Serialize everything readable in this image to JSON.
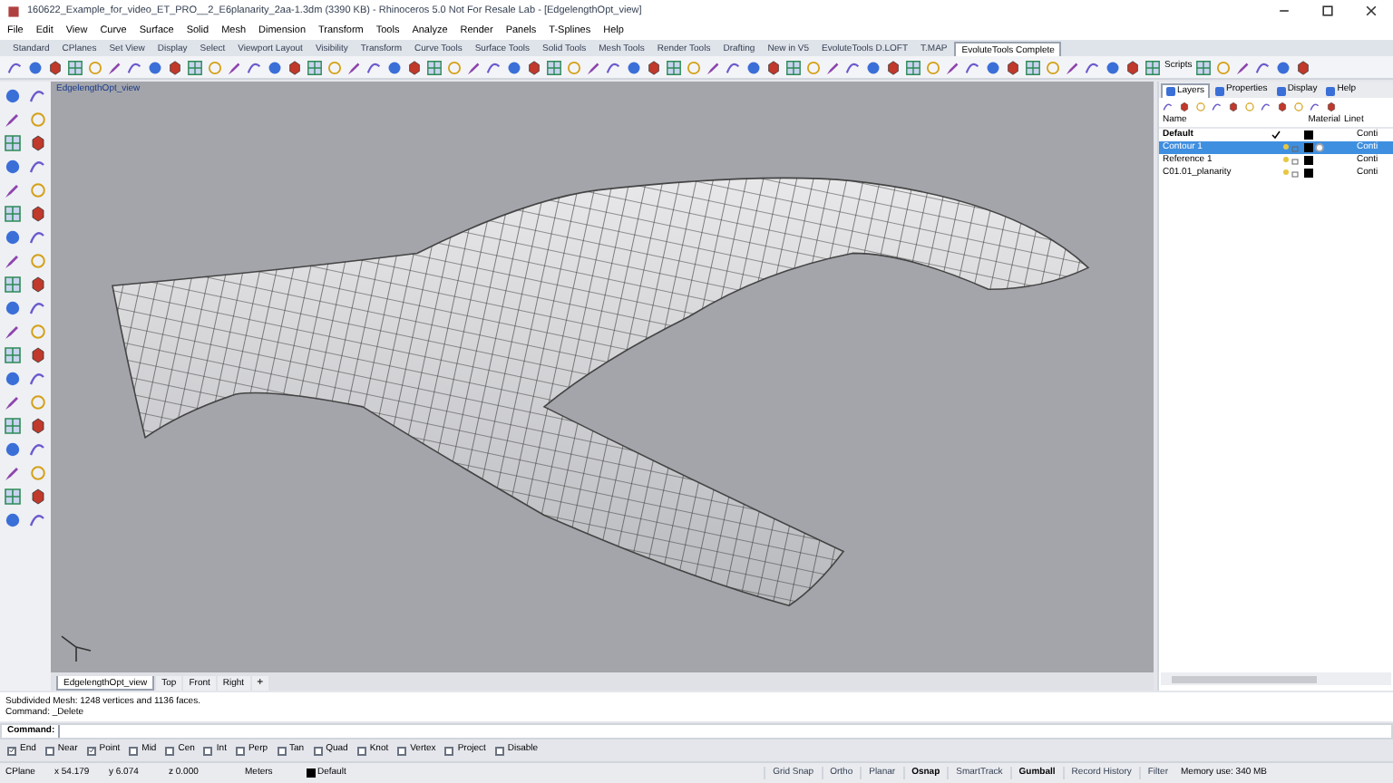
{
  "window": {
    "title": "160622_Example_for_video_ET_PRO__2_E6planarity_2aa-1.3dm (3390 KB) - Rhinoceros 5.0 Not For Resale Lab - [EdgelengthOpt_view]"
  },
  "menu": [
    "File",
    "Edit",
    "View",
    "Curve",
    "Surface",
    "Solid",
    "Mesh",
    "Dimension",
    "Transform",
    "Tools",
    "Analyze",
    "Render",
    "Panels",
    "T-Splines",
    "Help"
  ],
  "toolbar_tabs": [
    {
      "label": "Standard",
      "selected": false
    },
    {
      "label": "CPlanes",
      "selected": false
    },
    {
      "label": "Set View",
      "selected": false
    },
    {
      "label": "Display",
      "selected": false
    },
    {
      "label": "Select",
      "selected": false
    },
    {
      "label": "Viewport Layout",
      "selected": false
    },
    {
      "label": "Visibility",
      "selected": false
    },
    {
      "label": "Transform",
      "selected": false
    },
    {
      "label": "Curve Tools",
      "selected": false
    },
    {
      "label": "Surface Tools",
      "selected": false
    },
    {
      "label": "Solid Tools",
      "selected": false
    },
    {
      "label": "Mesh Tools",
      "selected": false
    },
    {
      "label": "Render Tools",
      "selected": false
    },
    {
      "label": "Drafting",
      "selected": false
    },
    {
      "label": "New in V5",
      "selected": false
    },
    {
      "label": "EvoluteTools D.LOFT",
      "selected": false
    },
    {
      "label": "T.MAP",
      "selected": false
    },
    {
      "label": "EvoluteTools Complete",
      "selected": true
    }
  ],
  "toolbar_label": "Scripts",
  "viewport": {
    "title": "EdgelengthOpt_view"
  },
  "viewport_tabs": [
    {
      "label": "EdgelengthOpt_view",
      "selected": true
    },
    {
      "label": "Top",
      "selected": false
    },
    {
      "label": "Front",
      "selected": false
    },
    {
      "label": "Right",
      "selected": false
    }
  ],
  "add_tab": "+",
  "panel_tabs": [
    {
      "label": "Layers",
      "selected": true
    },
    {
      "label": "Properties",
      "selected": false
    },
    {
      "label": "Display",
      "selected": false
    },
    {
      "label": "Help",
      "selected": false
    }
  ],
  "layers": {
    "columns": [
      "Name",
      "Material",
      "Linet"
    ],
    "rows": [
      {
        "name": "Default",
        "current": true,
        "selected": false,
        "color": "#000000",
        "has_material": false,
        "linetype": "Conti"
      },
      {
        "name": "Contour 1",
        "current": false,
        "selected": true,
        "color": "#000000",
        "has_material": true,
        "linetype": "Conti"
      },
      {
        "name": "Reference 1",
        "current": false,
        "selected": false,
        "color": "#000000",
        "has_material": false,
        "linetype": "Conti"
      },
      {
        "name": "C01.01_planarity",
        "current": false,
        "selected": false,
        "color": "#000000",
        "has_material": false,
        "linetype": "Conti"
      }
    ]
  },
  "command": {
    "history": [
      "Subdivided Mesh: 1248 vertices and 1136 faces.",
      "Command: _Delete"
    ],
    "prompt": "Command:"
  },
  "osnaps": [
    {
      "label": "End",
      "checked": true
    },
    {
      "label": "Near",
      "checked": false
    },
    {
      "label": "Point",
      "checked": true
    },
    {
      "label": "Mid",
      "checked": false
    },
    {
      "label": "Cen",
      "checked": false
    },
    {
      "label": "Int",
      "checked": false
    },
    {
      "label": "Perp",
      "checked": false
    },
    {
      "label": "Tan",
      "checked": false
    },
    {
      "label": "Quad",
      "checked": false
    },
    {
      "label": "Knot",
      "checked": false
    },
    {
      "label": "Vertex",
      "checked": false
    },
    {
      "label": "Project",
      "checked": false
    },
    {
      "label": "Disable",
      "checked": false
    }
  ],
  "status_bar": {
    "cplane": "CPlane",
    "x": "x 54.179",
    "y": "y 6.074",
    "z": "z 0.000",
    "units": "Meters",
    "layer": {
      "name": "Default",
      "color": "#000000"
    },
    "panes": [
      {
        "label": "Grid Snap",
        "active": false
      },
      {
        "label": "Ortho",
        "active": false
      },
      {
        "label": "Planar",
        "active": false
      },
      {
        "label": "Osnap",
        "active": true
      },
      {
        "label": "SmartTrack",
        "active": false
      },
      {
        "label": "Gumball",
        "active": true
      },
      {
        "label": "Record History",
        "active": false
      },
      {
        "label": "Filter",
        "active": false
      }
    ],
    "memory": "Memory use: 340 MB"
  }
}
